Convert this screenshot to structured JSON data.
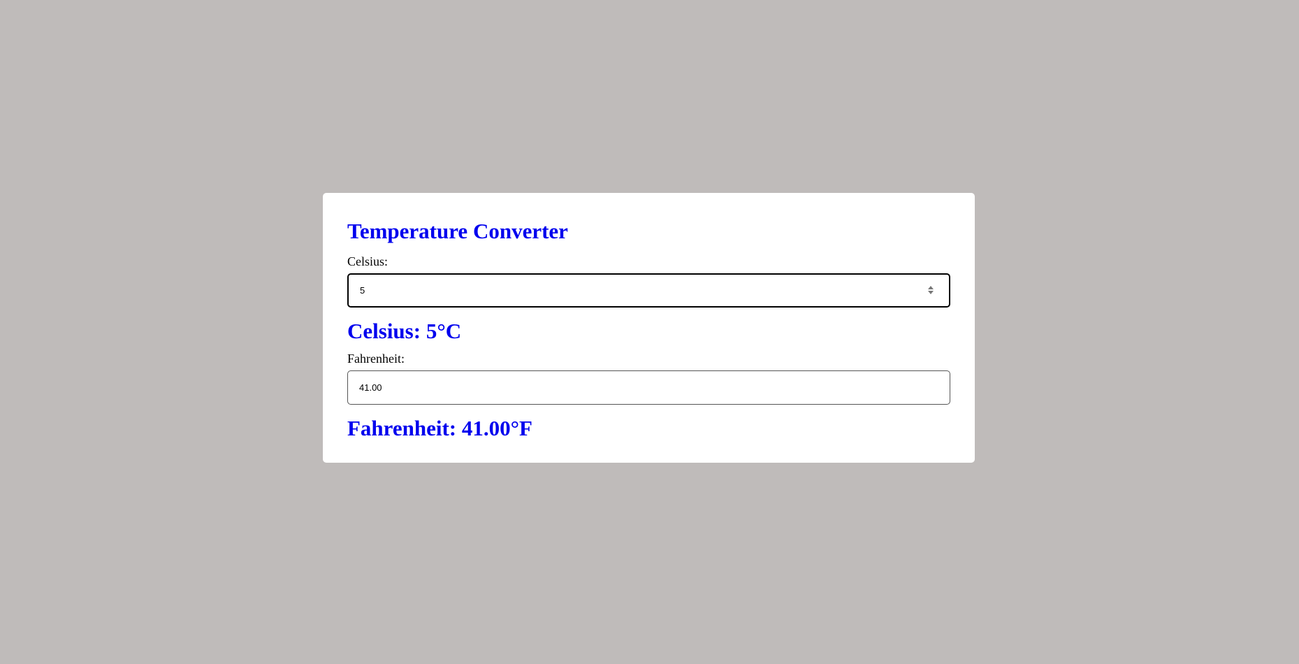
{
  "app": {
    "title": "Temperature Converter"
  },
  "celsius": {
    "label": "Celsius:",
    "value": "5",
    "result_text": "Celsius: 5°C"
  },
  "fahrenheit": {
    "label": "Fahrenheit:",
    "value": "41.00",
    "result_text": "Fahrenheit: 41.00°F"
  },
  "icons": {
    "spinner": "number-spinner-icon"
  },
  "colors": {
    "background": "#bfbbba",
    "card": "#ffffff",
    "accent": "#0000ee"
  }
}
